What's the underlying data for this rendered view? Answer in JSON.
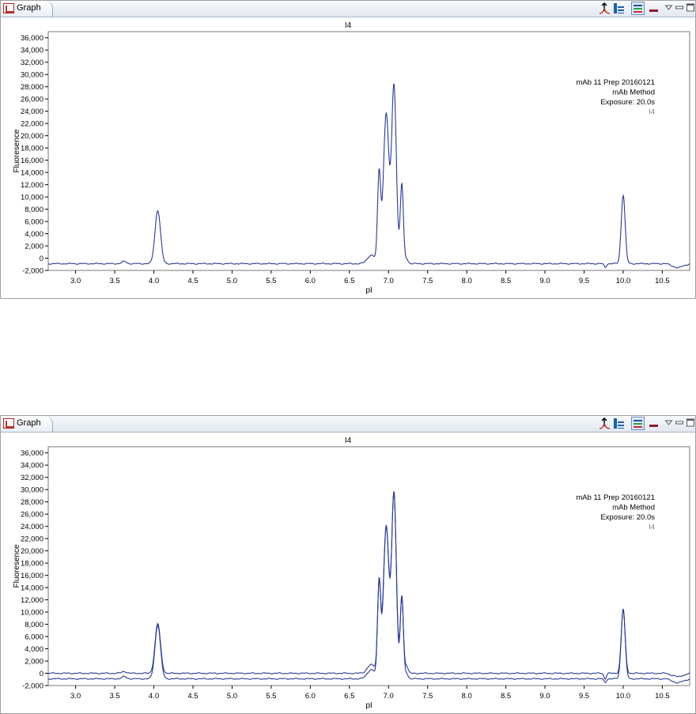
{
  "tab": {
    "label": "Graph"
  },
  "colors": {
    "trace": "#2b3a8f",
    "frame": "#a0a0a0"
  },
  "icons": [
    "peak-marker-icon",
    "peak-table-icon",
    "legend-icon",
    "minimize-icon",
    "view-menu-icon",
    "minimize-view-icon",
    "maximize-view-icon"
  ],
  "chart_data": [
    {
      "type": "line",
      "title": "I4",
      "xlabel": "pI",
      "ylabel": "Fluoresence",
      "xlim": [
        2.65,
        10.85
      ],
      "ylim": [
        -2000,
        37000
      ],
      "xticks": [
        "3.0",
        "3.5",
        "4.0",
        "4.5",
        "5.0",
        "5.5",
        "6.0",
        "6.5",
        "7.0",
        "7.5",
        "8.0",
        "8.5",
        "9.0",
        "9.5",
        "10.0",
        "10.5"
      ],
      "yticks": [
        "-2,000",
        "0",
        "2,000",
        "4,000",
        "6,000",
        "8,000",
        "10,000",
        "12,000",
        "14,000",
        "16,000",
        "18,000",
        "20,000",
        "22,000",
        "24,000",
        "26,000",
        "28,000",
        "30,000",
        "32,000",
        "34,000",
        "36,000"
      ],
      "legend": [
        "mAb 11 Prep 20160121",
        "mAb Method",
        "Exposure: 20.0s"
      ],
      "legend_trace": "I4",
      "legend_position": "top-right",
      "series": [
        {
          "baseline": -900,
          "peaks": [
            [
              3.62,
              350,
              0.03
            ],
            [
              4.05,
              8700,
              0.035
            ],
            [
              6.78,
              1400,
              0.05
            ],
            [
              6.88,
              14500,
              0.02
            ],
            [
              6.97,
              24500,
              0.035
            ],
            [
              7.07,
              29000,
              0.03
            ],
            [
              7.17,
              13000,
              0.02
            ],
            [
              7.23,
              800,
              0.02
            ],
            [
              9.77,
              -600,
              0.015
            ],
            [
              10.0,
              11200,
              0.025
            ]
          ],
          "end_drift": -700
        }
      ]
    },
    {
      "type": "line",
      "title": "I4",
      "xlabel": "pI",
      "ylabel": "Fluoresence",
      "xlim": [
        2.65,
        10.85
      ],
      "ylim": [
        -2000,
        37000
      ],
      "xticks": [
        "3.0",
        "3.5",
        "4.0",
        "4.5",
        "5.0",
        "5.5",
        "6.0",
        "6.5",
        "7.0",
        "7.5",
        "8.0",
        "8.5",
        "9.0",
        "9.5",
        "10.0",
        "10.5"
      ],
      "yticks": [
        "-2,000",
        "0",
        "2,000",
        "4,000",
        "6,000",
        "8,000",
        "10,000",
        "12,000",
        "14,000",
        "16,000",
        "18,000",
        "20,000",
        "22,000",
        "24,000",
        "26,000",
        "28,000",
        "30,000",
        "32,000",
        "34,000",
        "36,000"
      ],
      "legend": [
        "mAb 11 Prep 20160121",
        "mAb Method",
        "Exposure: 20.0s"
      ],
      "legend_trace": "I4",
      "legend_position": "top-right",
      "series": [
        {
          "baseline": -900,
          "peaks": [
            [
              3.62,
              350,
              0.03
            ],
            [
              4.05,
              8800,
              0.035
            ],
            [
              6.78,
              1500,
              0.05
            ],
            [
              6.88,
              15500,
              0.02
            ],
            [
              6.97,
              24800,
              0.035
            ],
            [
              7.07,
              30200,
              0.03
            ],
            [
              7.17,
              13500,
              0.02
            ],
            [
              7.23,
              900,
              0.02
            ],
            [
              9.77,
              -600,
              0.015
            ],
            [
              10.0,
              11500,
              0.025
            ]
          ],
          "end_drift": -700
        },
        {
          "baseline": 0,
          "peaks": [
            [
              3.62,
              300,
              0.03
            ],
            [
              4.05,
              8100,
              0.035
            ],
            [
              6.78,
              1400,
              0.05
            ],
            [
              6.88,
              14600,
              0.02
            ],
            [
              6.97,
              24000,
              0.035
            ],
            [
              7.07,
              29200,
              0.03
            ],
            [
              7.17,
              12500,
              0.02
            ],
            [
              7.23,
              1200,
              0.02
            ],
            [
              9.77,
              -900,
              0.015
            ],
            [
              10.0,
              10300,
              0.025
            ]
          ],
          "end_drift": -600
        }
      ]
    }
  ]
}
